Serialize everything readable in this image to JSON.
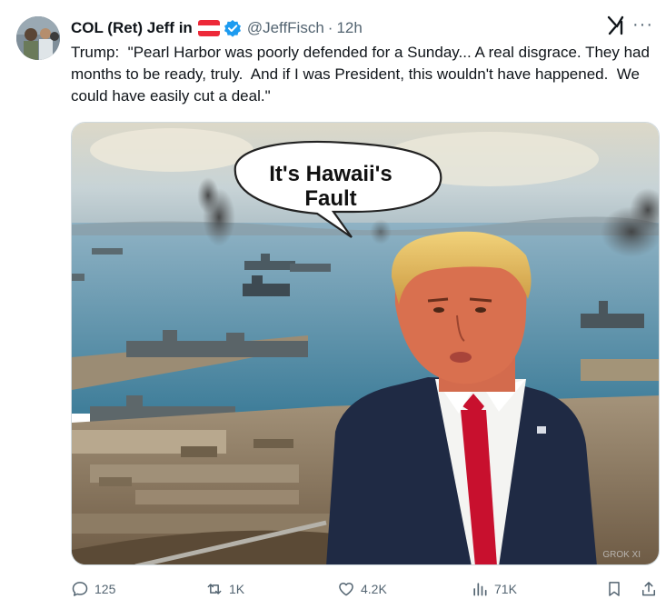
{
  "author": {
    "name": "COL (Ret) Jeff in",
    "handle": "@JeffFisch",
    "time": "12h",
    "dot": "·"
  },
  "tweet_text": "Trump:  \"Pearl Harbor was poorly defended for a Sunday... A real disgrace. They had months to be ready, truly.  And if I was President, this wouldn't have happened.  We could have easily cut a deal.\"",
  "media": {
    "speech_line1": "It's Hawaii's",
    "speech_line2": "Fault",
    "watermark": "GROK XI"
  },
  "actions": {
    "replies": "125",
    "reposts": "1K",
    "likes": "4.2K",
    "views": "71K"
  },
  "colors": {
    "accent": "#1d9bf0",
    "muted": "#536471",
    "tie": "#c8102e"
  },
  "icons": [
    "austria-flag-icon",
    "verified-badge-icon",
    "grok-icon",
    "more-icon",
    "reply-icon",
    "repost-icon",
    "like-icon",
    "views-icon",
    "bookmark-icon",
    "share-icon"
  ]
}
